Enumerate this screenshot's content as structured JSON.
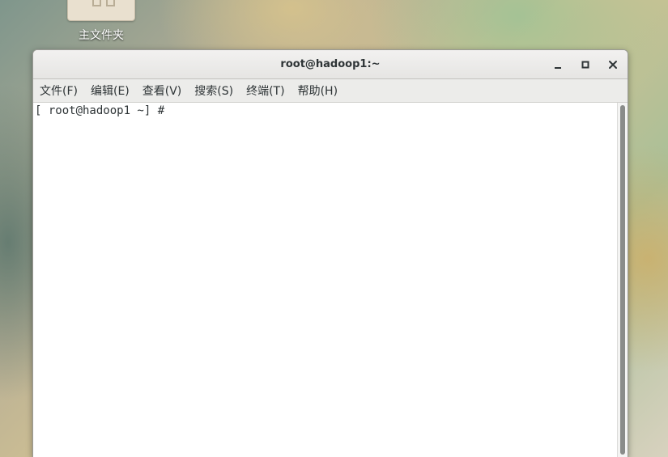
{
  "desktop": {
    "home_folder_label": "主文件夹",
    "home_folder_icon": "home-folder-icon"
  },
  "window": {
    "title": "root@hadoop1:~",
    "controls": {
      "minimize_icon": "minimize-icon",
      "maximize_icon": "maximize-icon",
      "close_icon": "close-icon"
    }
  },
  "menubar": {
    "items": [
      "文件(F)",
      "编辑(E)",
      "查看(V)",
      "搜索(S)",
      "终端(T)",
      "帮助(H)"
    ]
  },
  "terminal": {
    "prompt": "[ root@hadoop1 ~] # "
  },
  "colors": {
    "titlebar": "#e6e5e3",
    "menubar": "#ececea",
    "text": "#2e3436",
    "scroll_thumb": "#8a8c8a"
  }
}
